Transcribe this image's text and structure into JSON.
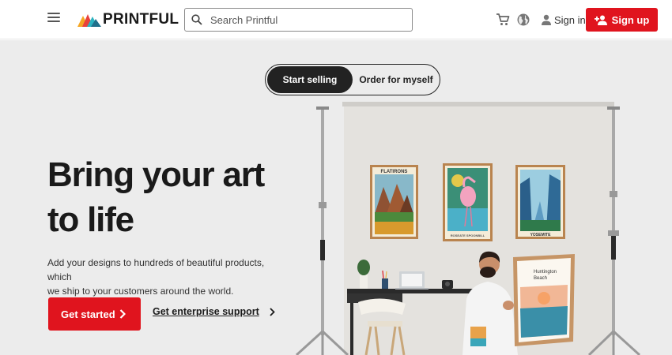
{
  "header": {
    "brand": "PRINTFUL",
    "search_placeholder": "Search Printful",
    "signin_label": "Sign in",
    "signup_label": "Sign up",
    "icons": [
      "menu-icon",
      "printful-logo",
      "search-icon",
      "cart-icon",
      "globe-icon",
      "user-icon",
      "add-user-icon"
    ]
  },
  "hero": {
    "toggle": {
      "active": "Start selling",
      "inactive": "Order for myself"
    },
    "headline_line1": "Bring your art",
    "headline_line2": "to life",
    "subtext_line1": "Add your designs to hundreds of beautiful products, which",
    "subtext_line2": "we ship to your customers around the world.",
    "cta_label": "Get started",
    "enterprise_label": "Get enterprise support"
  },
  "scene": {
    "poster_flatirons": "FLATIRONS",
    "poster_flamingo": "ROSEATE SPOONBILL",
    "poster_yosemite": "YOSEMITE",
    "poster_beach_line1": "Huntington",
    "poster_beach_line2": "Beach"
  },
  "colors": {
    "brand_red": "#e0141e",
    "dark": "#222222",
    "hero_bg": "#ececec"
  }
}
